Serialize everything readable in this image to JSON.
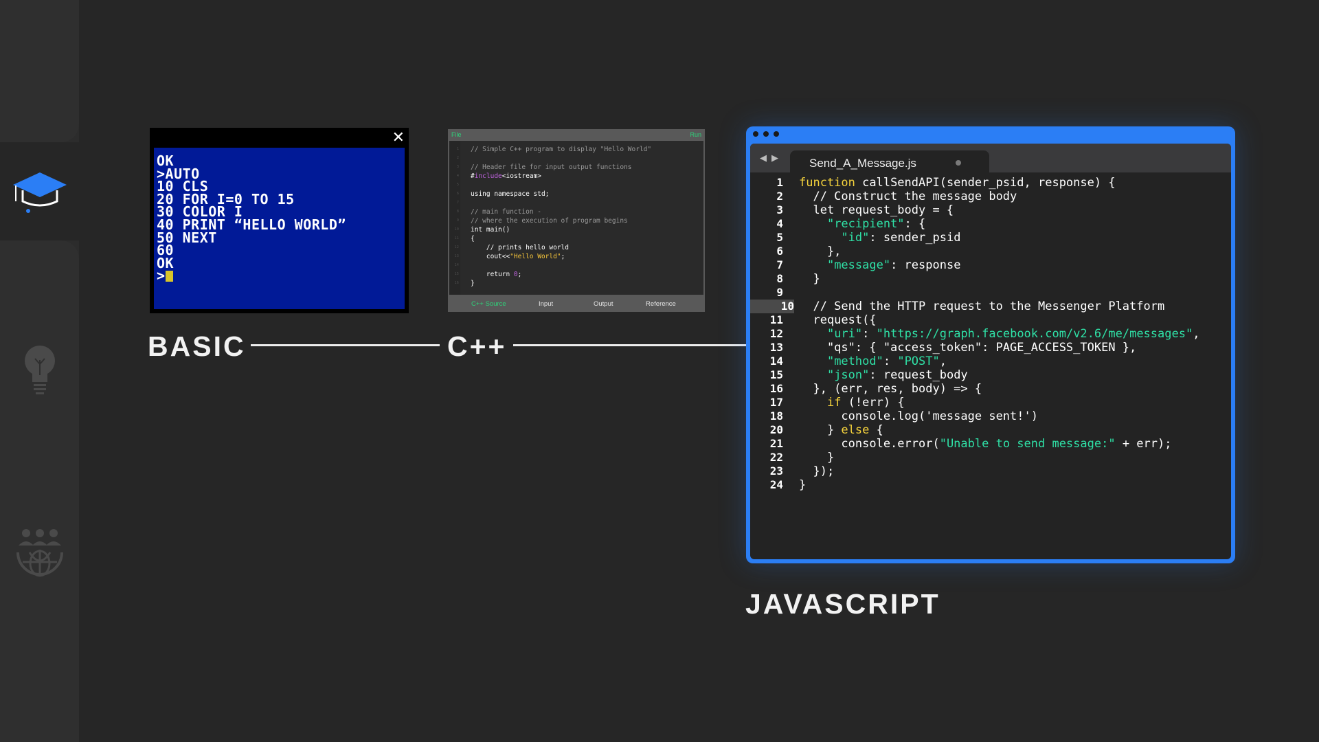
{
  "sidebar": {
    "icons": [
      "graduation-cap-icon",
      "lightbulb-icon",
      "global-community-icon"
    ],
    "active_index": 0
  },
  "basic": {
    "label": "BASIC",
    "lines": [
      "OK",
      ">AUTO",
      "10 CLS",
      "20 FOR I=0 TO 15",
      "30 COLOR I",
      "40 PRINT “HELLO WORLD”",
      "50 NEXT",
      "60",
      "OK",
      ">"
    ],
    "close_glyph": "✕",
    "screen_color": "#011a97"
  },
  "cpp": {
    "label": "C++",
    "menu_file": "File",
    "menu_run": "Run",
    "code_lines": [
      "// Simple C++ program to display \"Hello World\"",
      "",
      "// Header file for input output functions",
      "#include<iostream>",
      "",
      "using namespace std;",
      "",
      "// main function -",
      "// where the execution of program begins",
      "int main()",
      "{",
      "    // prints hello world",
      "    cout<<\"Hello World\";",
      "",
      "    return 0;",
      "}"
    ],
    "tabs": [
      "C++ Source",
      "Input",
      "Output",
      "Reference"
    ],
    "active_tab": "C++ Source"
  },
  "js": {
    "label": "JAVASCRIPT",
    "filename": "Send_A_Message.js",
    "accent": "#2b7ef5",
    "highlighted_line": "10",
    "line_numbers": [
      "1",
      "2",
      "3",
      "4",
      "5",
      "6",
      "7",
      "8",
      "9",
      "10",
      "11",
      "12",
      "13",
      "14",
      "15",
      "16",
      "17",
      "18",
      "20",
      "21",
      "22",
      "23",
      "24"
    ],
    "code_lines": [
      "function callSendAPI(sender_psid, response) {",
      "  // Construct the message body",
      "  let request_body = {",
      "    \"recipient\": {",
      "      \"id\": sender_psid",
      "    },",
      "    \"message\": response",
      "  }",
      "",
      "  // Send the HTTP request to the Messenger Platform",
      "  request({",
      "    \"uri\": \"https://graph.facebook.com/v2.6/me/messages\",",
      "    \"qs\": { \"access_token\": PAGE_ACCESS_TOKEN },",
      "    \"method\": \"POST\",",
      "    \"json\": request_body",
      "  }, (err, res, body) => {",
      "    if (!err) {",
      "      console.log('message sent!')",
      "    } else {",
      "      console.error(\"Unable to send message:\" + err);",
      "    }",
      "  });",
      "}"
    ]
  }
}
